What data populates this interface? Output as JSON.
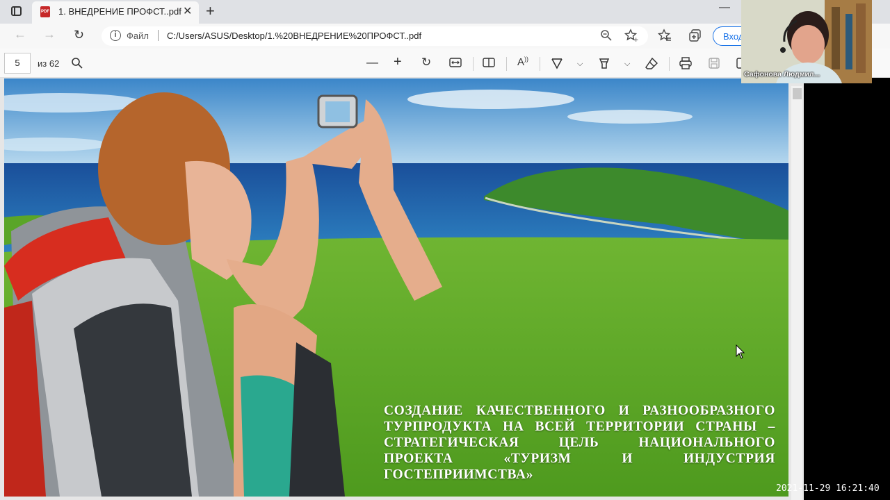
{
  "tab": {
    "title": "1. ВНЕДРЕНИЕ ПРОФСТ..pdf",
    "close": "✕",
    "new_tab": "+"
  },
  "address": {
    "file_label": "Файл",
    "url": "C:/Users/ASUS/Desktop/1.%20ВНЕДРЕНИЕ%20ПРОФСТ..pdf",
    "login_label": "Вход"
  },
  "pdf_toolbar": {
    "current_page": "5",
    "of_pages": "из 62"
  },
  "slide": {
    "caption": "СОЗДАНИЕ КАЧЕСТВЕННОГО И РАЗНООБРАЗНОГО ТУРПРОДУКТА НА ВСЕЙ ТЕРРИТОРИИ СТРАНЫ – СТРАТЕГИЧЕСКАЯ ЦЕЛЬ НАЦИОНАЛЬНОГО ПРОЕКТА «ТУРИЗМ И ИНДУСТРИЯ ГОСТЕПРИИМСТВА»"
  },
  "webcam": {
    "participant": "Сафонова Людмил..."
  },
  "timestamp": "2021-11-29  16:21:40",
  "icons": [
    "tab-actions-icon",
    "pdf-file-icon",
    "back-icon",
    "forward-icon",
    "reload-icon",
    "info-icon",
    "zoom-icon",
    "favorite-add-icon",
    "favorites-icon",
    "collections-icon",
    "search-icon",
    "zoom-out-icon",
    "zoom-in-icon",
    "rotate-icon",
    "fit-width-icon",
    "page-view-icon",
    "read-aloud-icon",
    "draw-icon",
    "highlight-icon",
    "erase-icon",
    "print-icon",
    "save-icon"
  ],
  "colors": {
    "accent": "#1a73e8",
    "pdf_red": "#c62828"
  }
}
